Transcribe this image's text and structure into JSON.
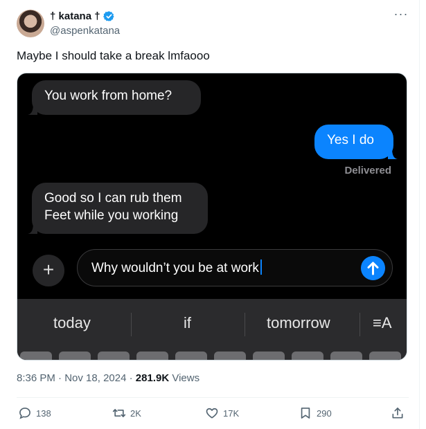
{
  "author": {
    "display_name": "† katana †",
    "handle": "@aspenkatana",
    "verified_icon": "verified-badge-icon",
    "accent": "#1d9bf0"
  },
  "tweet": {
    "text": "Maybe I should take a break lmfaooo"
  },
  "media": {
    "messages": [
      {
        "from": "them",
        "text": "You work from home?"
      },
      {
        "from": "me",
        "text": "Yes I do"
      },
      {
        "from": "them",
        "text": "Good so I can rub them\nFeet while you working"
      }
    ],
    "delivered_label": "Delivered",
    "compose_text": "Why wouldn’t you be at work",
    "suggestions": [
      "today",
      "if",
      "tomorrow"
    ],
    "format_icon": "≡A",
    "bubble_color_out": "#0b84fe",
    "bubble_color_in": "#262628"
  },
  "meta": {
    "time": "8:36 PM",
    "date": "Nov 18, 2024",
    "views_count": "281.9K",
    "views_label": "Views"
  },
  "actions": {
    "replies": "138",
    "reposts": "2K",
    "likes": "17K",
    "bookmarks": "290"
  }
}
